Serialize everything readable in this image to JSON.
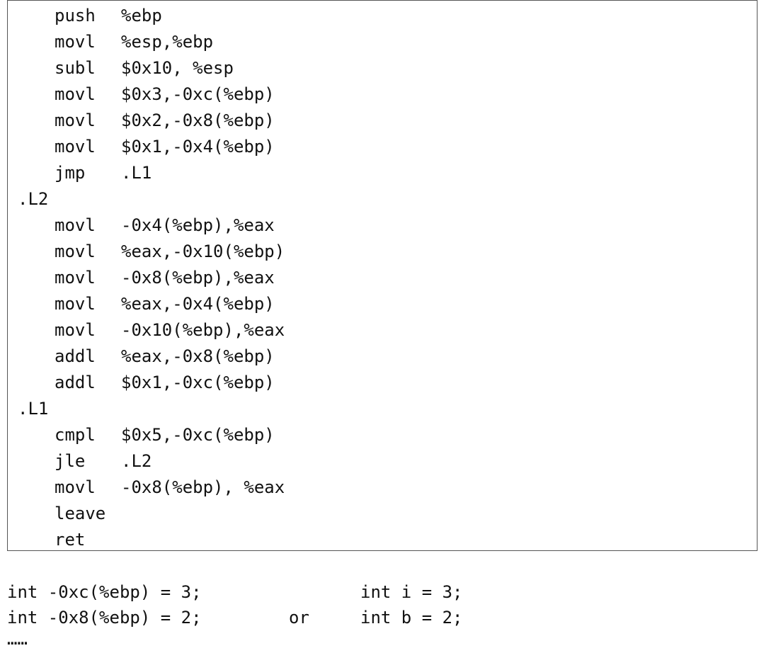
{
  "listing": [
    {
      "kind": "instr",
      "mnemonic": "push",
      "operand": "%ebp"
    },
    {
      "kind": "instr",
      "mnemonic": "movl",
      "operand": "%esp,%ebp"
    },
    {
      "kind": "instr",
      "mnemonic": "subl",
      "operand": "$0x10, %esp"
    },
    {
      "kind": "instr",
      "mnemonic": "movl",
      "operand": "$0x3,-0xc(%ebp)"
    },
    {
      "kind": "instr",
      "mnemonic": "movl",
      "operand": "$0x2,-0x8(%ebp)"
    },
    {
      "kind": "instr",
      "mnemonic": "movl",
      "operand": "$0x1,-0x4(%ebp)"
    },
    {
      "kind": "instr",
      "mnemonic": "jmp",
      "operand": ".L1"
    },
    {
      "kind": "label",
      "text": ".L2"
    },
    {
      "kind": "instr",
      "mnemonic": "movl",
      "operand": "-0x4(%ebp),%eax"
    },
    {
      "kind": "instr",
      "mnemonic": "movl",
      "operand": "%eax,-0x10(%ebp)"
    },
    {
      "kind": "instr",
      "mnemonic": "movl",
      "operand": "-0x8(%ebp),%eax"
    },
    {
      "kind": "instr",
      "mnemonic": "movl",
      "operand": "%eax,-0x4(%ebp)"
    },
    {
      "kind": "instr",
      "mnemonic": "movl",
      "operand": "-0x10(%ebp),%eax"
    },
    {
      "kind": "instr",
      "mnemonic": "addl",
      "operand": "%eax,-0x8(%ebp)"
    },
    {
      "kind": "instr",
      "mnemonic": "addl",
      "operand": "$0x1,-0xc(%ebp)"
    },
    {
      "kind": "label",
      "text": ".L1"
    },
    {
      "kind": "instr",
      "mnemonic": "cmpl",
      "operand": "$0x5,-0xc(%ebp)"
    },
    {
      "kind": "instr",
      "mnemonic": "jle",
      "operand": ".L2"
    },
    {
      "kind": "instr",
      "mnemonic": "movl",
      "operand": "-0x8(%ebp), %eax"
    },
    {
      "kind": "instr",
      "mnemonic": "leave",
      "operand": ""
    },
    {
      "kind": "instr",
      "mnemonic": "ret",
      "operand": ""
    }
  ],
  "notes": {
    "line1_left": "int -0xc(%ebp) = 3;",
    "line1_right": "int i = 3;",
    "line2_left": "int -0x8(%ebp) = 2;",
    "line2_mid": "or",
    "line2_right": "int b = 2;",
    "line3": "……"
  }
}
